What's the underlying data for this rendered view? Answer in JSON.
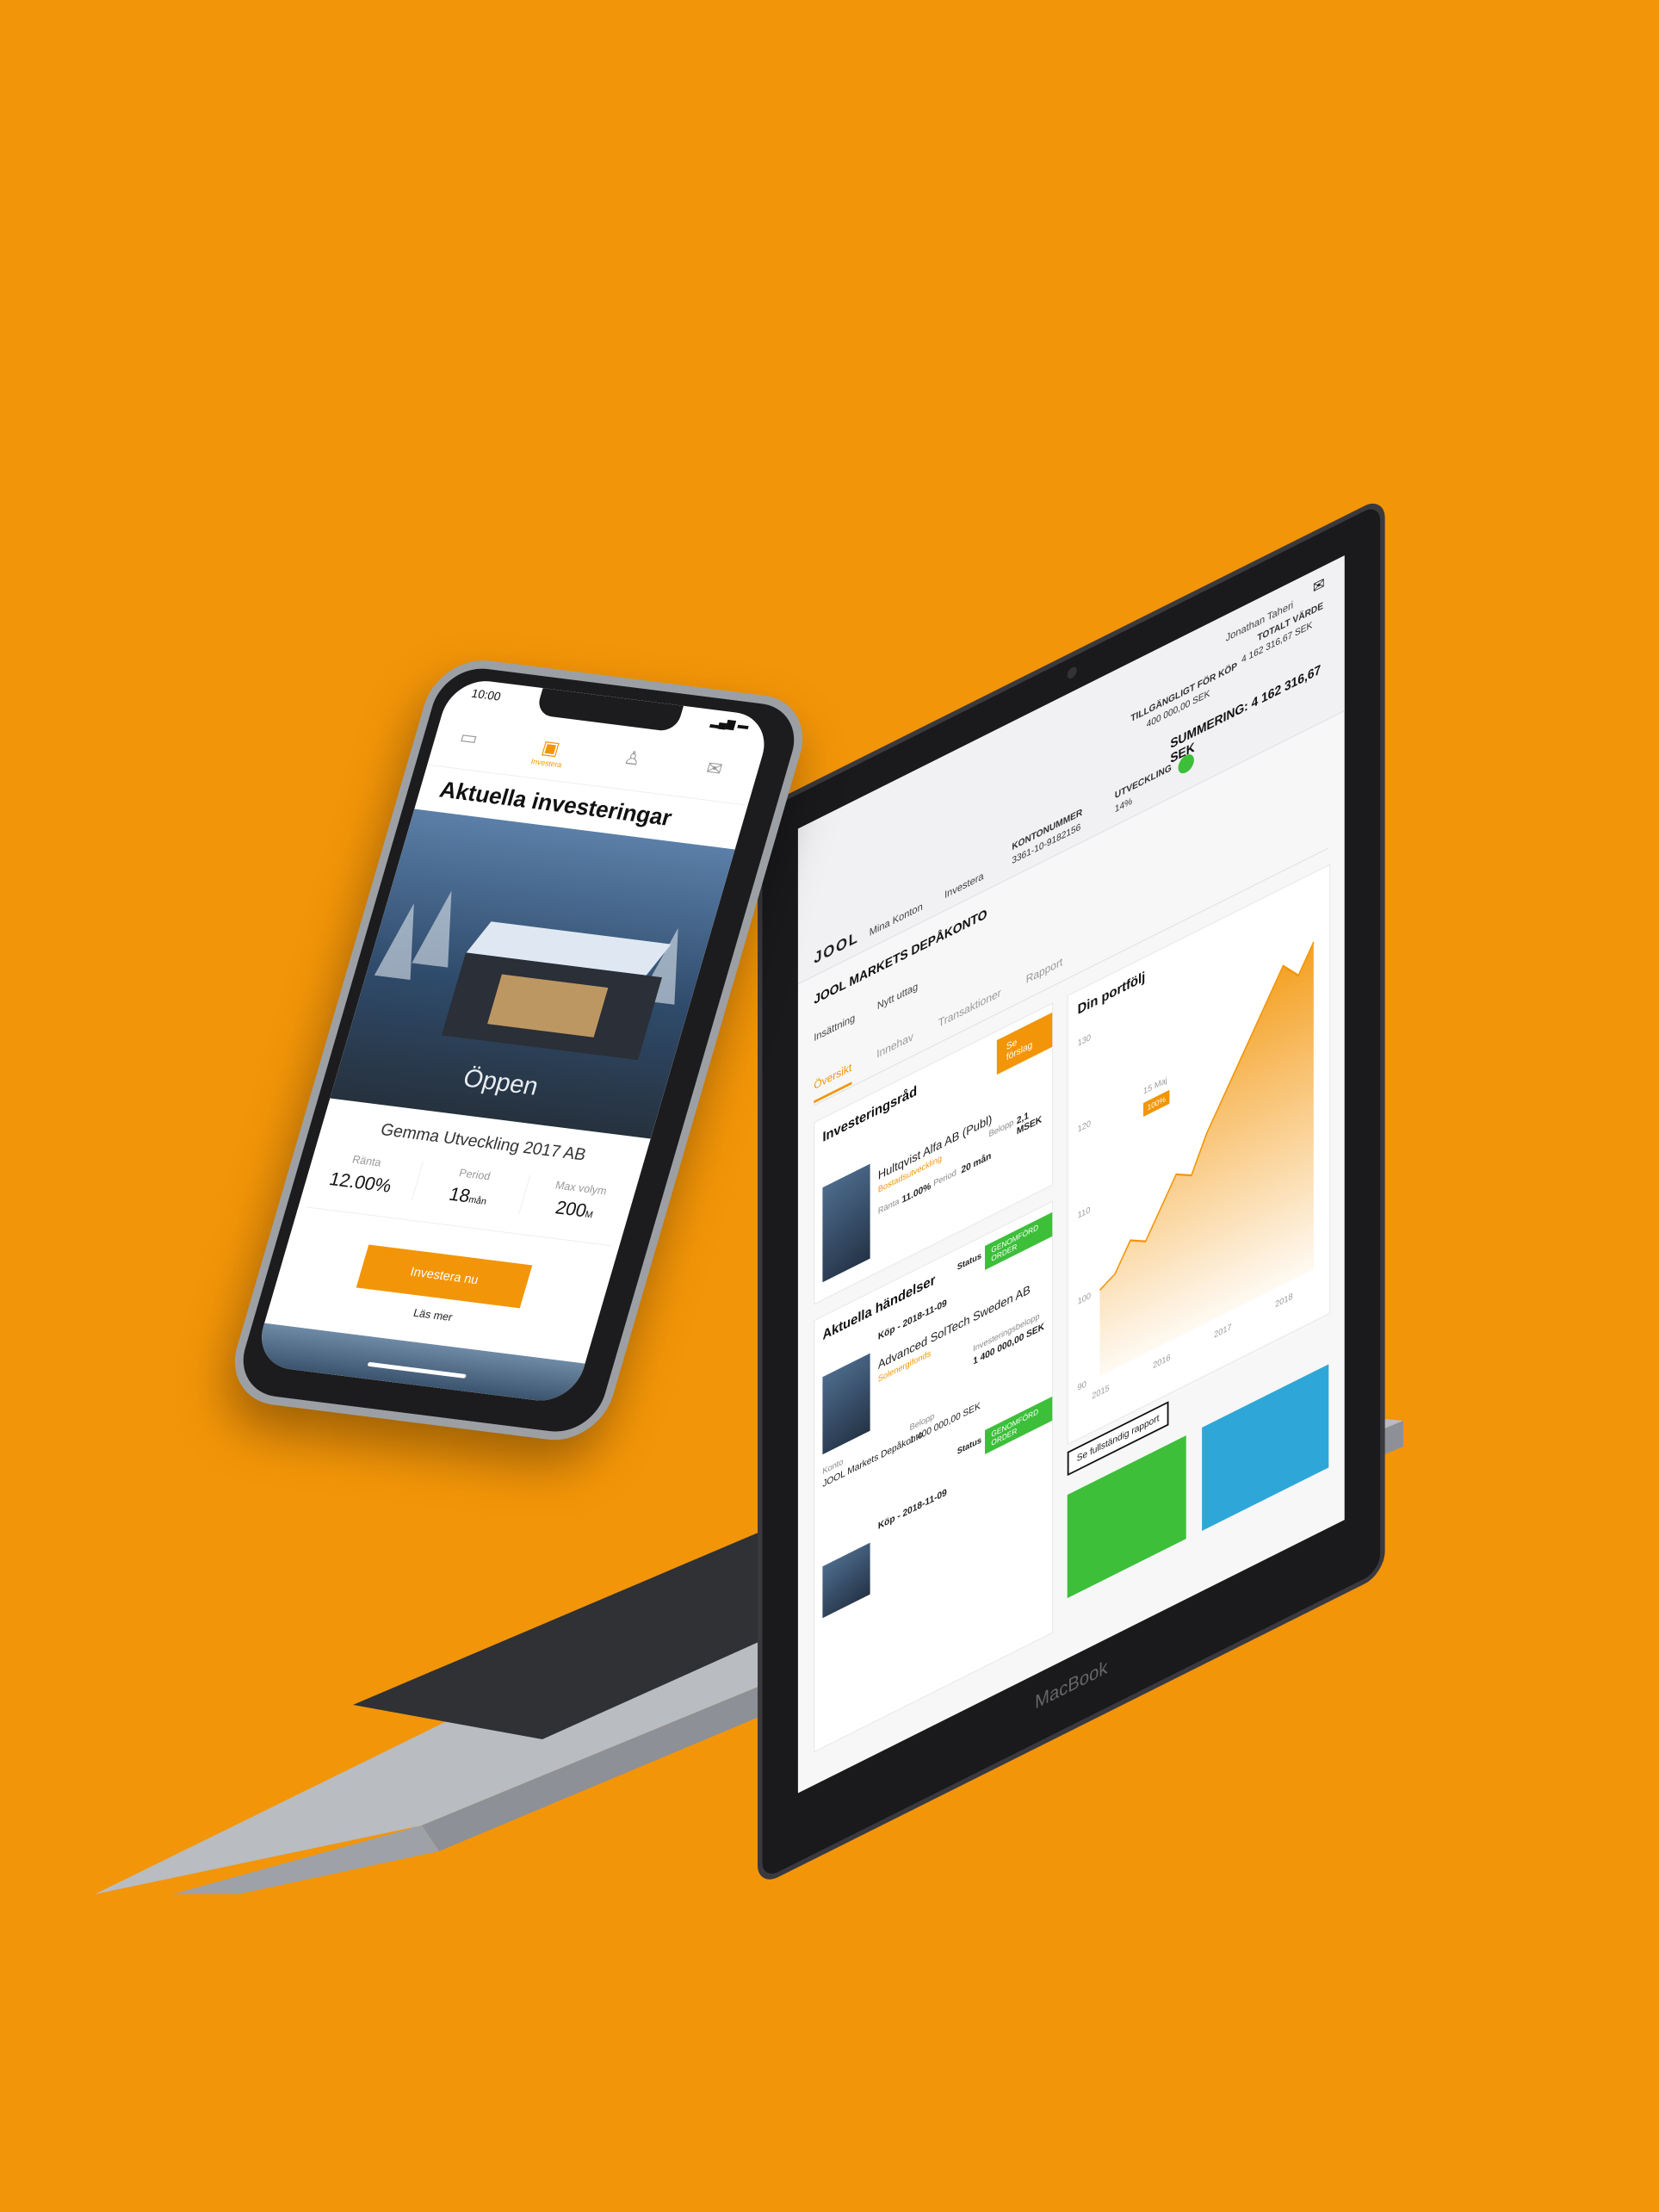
{
  "phone": {
    "time": "10:00",
    "tabs": [
      {
        "icon": "folder-icon",
        "label": ""
      },
      {
        "icon": "investments-icon",
        "label": "Investera"
      },
      {
        "icon": "user-icon",
        "label": ""
      },
      {
        "icon": "mail-icon",
        "label": ""
      }
    ],
    "title": "Aktuella investeringar",
    "hero_status": "Öppen",
    "company": "Gemma Utveckling 2017 AB",
    "stats": [
      {
        "label": "Ränta",
        "value": "12.00%",
        "unit": ""
      },
      {
        "label": "Period",
        "value": "18",
        "unit": "mån"
      },
      {
        "label": "Max volym",
        "value": "200",
        "unit": "M"
      }
    ],
    "invest_button": "Investera nu",
    "read_more": "Läs mer"
  },
  "laptop": {
    "brand": "MacBook",
    "logo": "JOOL",
    "nav": [
      "Mina Konton",
      "Investera"
    ],
    "user": "Jonathan Taheri",
    "account_label": "KONTONUMMER",
    "account_number": "3361-10-9182156",
    "account_name": "JOOL MARKETS DEPÅKONTO",
    "development_label": "UTVECKLING",
    "development_value": "14%",
    "available_label": "TILLGÄNGLIGT FÖR KÖP",
    "available_value": "400 000,00 SEK",
    "total_label": "TOTALT VÄRDE",
    "total_value": "4 162 316,67 SEK",
    "summary": "SUMMERING: 4 162 316,67 SEK",
    "actions": [
      "Insättning",
      "Nytt uttag"
    ],
    "tabs": [
      "Översikt",
      "Innehav",
      "Transaktioner",
      "Rapport"
    ],
    "advice": {
      "title": "Investeringsråd",
      "button": "Se förslag",
      "company": "Hultqvist Alfa AB (Publ)",
      "tag": "Bostadsutveckling",
      "rate_label": "Ränta",
      "rate": "11.00%",
      "period_label": "Period",
      "period": "20 mån",
      "amount_label": "Belopp",
      "amount": "2,1 MSEK"
    },
    "events": {
      "title": "Aktuella händelser",
      "status_label": "Status",
      "status": "GENOMFÖRD ORDER",
      "items": [
        {
          "date": "Köp - 2018-11-09",
          "company": "Advanced SolTech Sweden AB",
          "tag": "Solenergifonds",
          "account_label": "Konto",
          "account": "JOOL Markets Depåkonto",
          "amount_label": "Belopp",
          "amount": "1 400 000,00 SEK",
          "invest_label": "Investeringsbelopp",
          "invest": "1 400 000,00 SEK"
        },
        {
          "date": "Köp - 2018-11-09",
          "company": "",
          "tag": ""
        }
      ]
    },
    "portfolio": {
      "title": "Din portfölj",
      "report_button": "Se fullständig rapport",
      "marker": "15 Maj",
      "marker_value": "100%"
    }
  },
  "chart_data": {
    "type": "area",
    "title": "Din portfölj",
    "x": [
      2015,
      2015.25,
      2015.5,
      2015.75,
      2016,
      2016.25,
      2016.5,
      2016.75,
      2017,
      2017.25,
      2017.5,
      2017.75,
      2018,
      2018.25,
      2018.5
    ],
    "values": [
      100,
      101,
      104,
      103,
      106,
      109,
      108,
      112,
      115,
      118,
      121,
      124,
      127,
      125,
      128
    ],
    "xticks": [
      "2015",
      "2016",
      "2017",
      "2018"
    ],
    "yticks": [
      "90",
      "100",
      "110",
      "120",
      "130"
    ],
    "ylim": [
      90,
      130
    ],
    "color": "#F39508"
  },
  "colors": {
    "background": "#F39508",
    "accent": "#F39508",
    "success": "#3dbf3a",
    "blue": "#2ea7d8"
  }
}
